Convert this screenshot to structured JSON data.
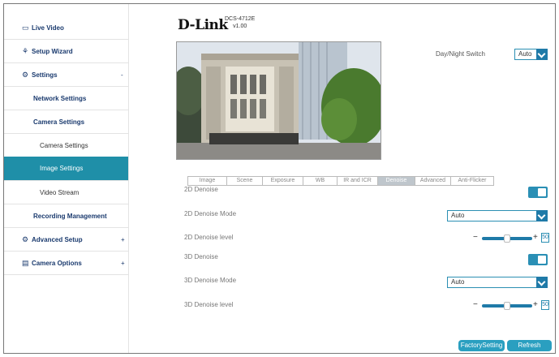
{
  "sidebar": {
    "items": [
      {
        "label": "Live Video",
        "icon": "monitor-icon",
        "glyph": "▭"
      },
      {
        "label": "Setup Wizard",
        "icon": "wand-icon",
        "glyph": "⚘"
      },
      {
        "label": "Settings",
        "icon": "gear-icon",
        "glyph": "⚙",
        "marker": "-"
      },
      {
        "label": "Network Settings"
      },
      {
        "label": "Camera Settings"
      },
      {
        "label": "Camera Settings"
      },
      {
        "label": "Image Settings"
      },
      {
        "label": "Video Stream"
      },
      {
        "label": "Recording Management"
      },
      {
        "label": "Advanced Setup",
        "icon": "advanced-icon",
        "glyph": "⚙",
        "marker": "+"
      },
      {
        "label": "Camera Options",
        "icon": "document-icon",
        "glyph": "▤",
        "marker": "+"
      }
    ]
  },
  "header": {
    "logo": "D-Link",
    "model": "DCS-4712E",
    "version": "v1.00"
  },
  "daynight": {
    "label": "Day/Night Switch",
    "value": "Auto"
  },
  "tabs": [
    "Image",
    "Scene",
    "Exposure",
    "WB",
    "IR and ICR",
    "Denoise",
    "Advanced",
    "Anti-Flicker"
  ],
  "active_tab": "Denoise",
  "settings": {
    "denoise_2d": {
      "label": "2D Denoise",
      "on": true
    },
    "denoise_2d_mode": {
      "label": "2D Denoise Mode",
      "value": "Auto"
    },
    "denoise_2d_level": {
      "label": "2D Denoise level",
      "value": "50",
      "minus": "−",
      "plus": "+"
    },
    "denoise_3d": {
      "label": "3D Denoise",
      "on": true
    },
    "denoise_3d_mode": {
      "label": "3D Denoise Mode",
      "value": "Auto"
    },
    "denoise_3d_level": {
      "label": "3D Denoise level",
      "value": "50",
      "minus": "−",
      "plus": "+"
    }
  },
  "buttons": {
    "factory": "FactorySetting",
    "refresh": "Refresh"
  },
  "colors": {
    "accent": "#1f8fa8",
    "select_arrow": "#1f7aa8",
    "nav_text": "#1a3a6e"
  }
}
